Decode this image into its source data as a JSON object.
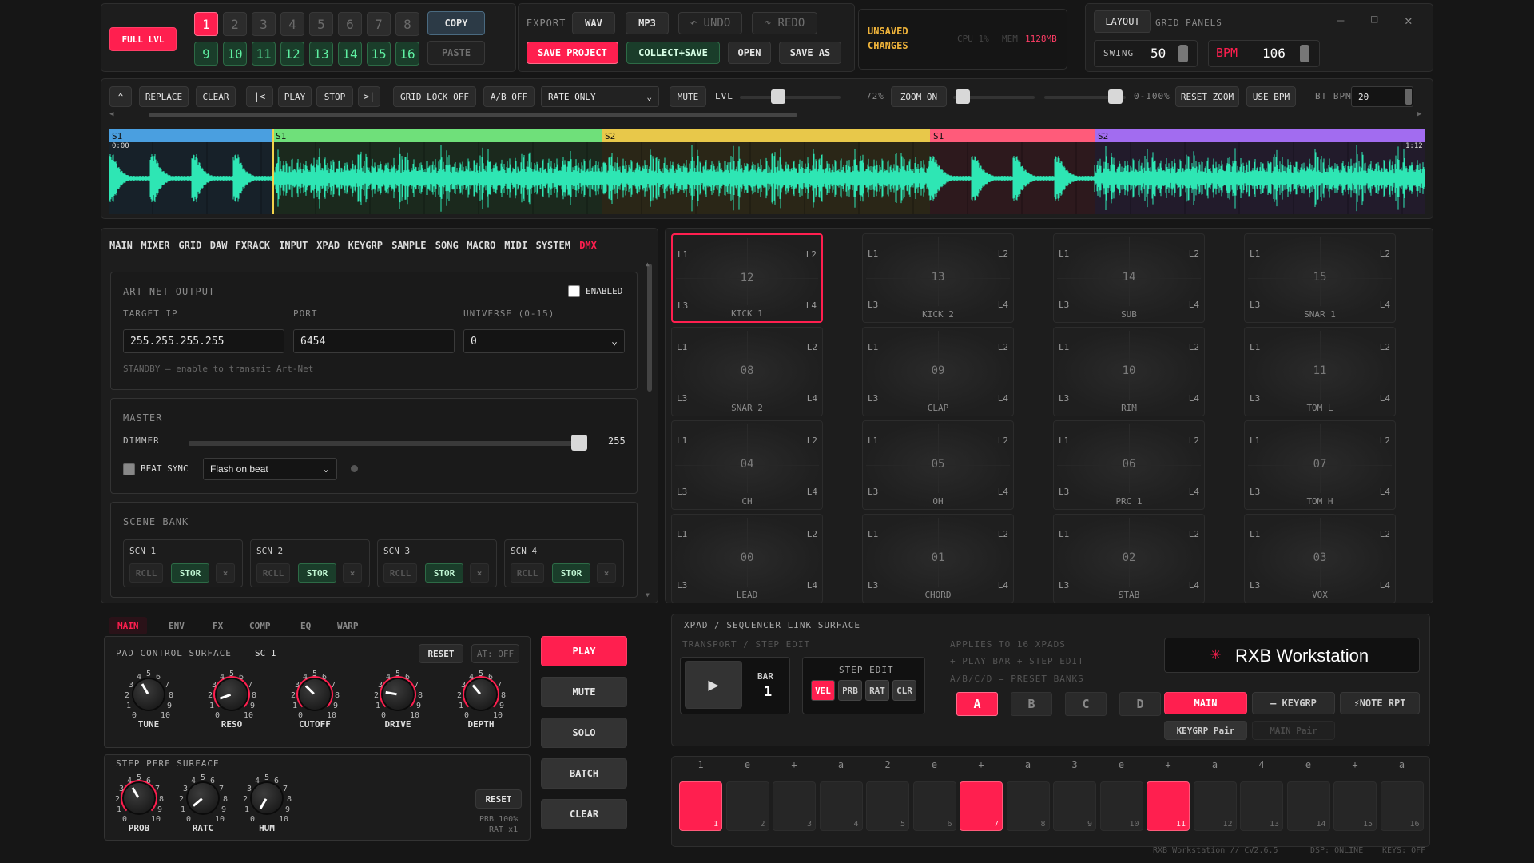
{
  "top": {
    "full_lvl": "FULL LVL",
    "slots": [
      "1",
      "2",
      "3",
      "4",
      "5",
      "6",
      "7",
      "8"
    ],
    "slots2": [
      "9",
      "10",
      "11",
      "12",
      "13",
      "14",
      "15",
      "16"
    ],
    "copy": "COPY",
    "paste": "PASTE",
    "export_label": "EXPORT",
    "wav": "WAV",
    "mp3": "MP3",
    "undo": "↶ UNDO",
    "redo": "↷ REDO",
    "save_project": "SAVE PROJECT",
    "collect_save": "COLLECT+SAVE",
    "open": "OPEN",
    "save_as": "SAVE AS",
    "unsaved": "UNSAVED",
    "changes": "CHANGES",
    "cpu": "CPU 1%",
    "mem_label": "MEM",
    "mem_value": "1128MB",
    "layout": "LAYOUT",
    "grid_panels": "GRID PANELS",
    "swing_label": "SWING",
    "swing_value": "50",
    "bpm_label": "BPM",
    "bpm_value": "106"
  },
  "transport": {
    "replace": "REPLACE",
    "clear": "CLEAR",
    "to_start": "|<",
    "play": "PLAY",
    "stop": "STOP",
    "to_end": ">|",
    "grid_lock": "GRID LOCK OFF",
    "ab": "A/B OFF",
    "rate_only": "RATE ONLY",
    "mute": "MUTE",
    "lvl": "LVL",
    "lvl_value": "72%",
    "zoom_on": "ZOOM ON",
    "range": "0-100%",
    "reset_zoom": "RESET ZOOM",
    "use_bpm": "USE BPM",
    "bt_bpm_label": "BT BPM",
    "bt_bpm_value": "20"
  },
  "waveform": {
    "time_start": "0:00",
    "time_end": "1:12",
    "segments": [
      {
        "label": "S1",
        "color": "#4a9fe0"
      },
      {
        "label": "S1",
        "color": "#6fe07a"
      },
      {
        "label": "S2",
        "color": "#e8c84a"
      },
      {
        "label": "S1",
        "color": "#ff5b7a"
      },
      {
        "label": "S2",
        "color": "#a26cf0"
      }
    ],
    "wave_color": "#2ee6b4"
  },
  "nav": {
    "tabs": [
      "MAIN",
      "MIXER",
      "GRID",
      "DAW",
      "FXRACK",
      "INPUT",
      "XPAD",
      "KEYGRP",
      "SAMPLE",
      "SONG",
      "MACRO",
      "MIDI",
      "SYSTEM",
      "DMX"
    ]
  },
  "artnet": {
    "title": "ART-NET OUTPUT",
    "enabled": "ENABLED",
    "ip_label": "TARGET IP",
    "ip": "255.255.255.255",
    "port_label": "PORT",
    "port": "6454",
    "universe_label": "UNIVERSE (0-15)",
    "universe": "0",
    "status": "STANDBY — enable to transmit Art-Net"
  },
  "master": {
    "title": "MASTER",
    "dimmer_label": "DIMMER",
    "dimmer_value": "255",
    "beat_sync": "BEAT SYNC",
    "flash": "Flash on beat"
  },
  "scenes": {
    "title": "SCENE BANK",
    "items": [
      {
        "name": "SCN 1"
      },
      {
        "name": "SCN 2"
      },
      {
        "name": "SCN 3"
      },
      {
        "name": "SCN 4"
      }
    ],
    "rcll": "RCLL",
    "stor": "STOR",
    "x": "×"
  },
  "pads": [
    {
      "num": "12",
      "name": "KICK 1"
    },
    {
      "num": "13",
      "name": "KICK 2"
    },
    {
      "num": "14",
      "name": "SUB"
    },
    {
      "num": "15",
      "name": "SNAR 1"
    },
    {
      "num": "08",
      "name": "SNAR 2"
    },
    {
      "num": "09",
      "name": "CLAP"
    },
    {
      "num": "10",
      "name": "RIM"
    },
    {
      "num": "11",
      "name": "TOM L"
    },
    {
      "num": "04",
      "name": "CH"
    },
    {
      "num": "05",
      "name": "OH"
    },
    {
      "num": "06",
      "name": "PRC 1"
    },
    {
      "num": "07",
      "name": "TOM H"
    },
    {
      "num": "00",
      "name": "LEAD"
    },
    {
      "num": "01",
      "name": "CHORD"
    },
    {
      "num": "02",
      "name": "STAB"
    },
    {
      "num": "03",
      "name": "VOX"
    }
  ],
  "pad_corners": {
    "l1": "L1",
    "l2": "L2",
    "l3": "L3",
    "l4": "L4"
  },
  "padctl": {
    "tabs": [
      "MAIN",
      "ENV",
      "FX",
      "COMP",
      "EQ",
      "WARP"
    ],
    "title": "PAD CONTROL SURFACE",
    "sc": "SC 1",
    "reset": "RESET",
    "at": "AT: OFF",
    "knobs": [
      {
        "label": "TUNE"
      },
      {
        "label": "RESO"
      },
      {
        "label": "CUTOFF"
      },
      {
        "label": "DRIVE"
      },
      {
        "label": "DEPTH"
      }
    ]
  },
  "steperf": {
    "title": "STEP PERF SURFACE",
    "reset": "RESET",
    "prb": "PRB 100%",
    "rat": "RAT x1",
    "knobs": [
      {
        "label": "PROB"
      },
      {
        "label": "RATC"
      },
      {
        "label": "HUM"
      }
    ]
  },
  "side": {
    "play": "PLAY",
    "mute": "MUTE",
    "solo": "SOLO",
    "batch": "BATCH",
    "clear": "CLEAR"
  },
  "xpad": {
    "title": "XPAD / SEQUENCER LINK SURFACE",
    "sub": "TRANSPORT / STEP EDIT",
    "bar_label": "BAR",
    "bar_value": "1",
    "step_edit": "STEP EDIT",
    "modes": [
      "VEL",
      "PRB",
      "RAT",
      "CLR"
    ],
    "applies": "APPLIES TO 16 XPADS",
    "play_bar": "+ PLAY BAR + STEP EDIT",
    "presets": "A/B/C/D = PRESET BANKS",
    "banks": [
      "A",
      "B",
      "C",
      "D"
    ],
    "brand": "RXB Workstation",
    "main": "MAIN",
    "keygrp": "— KEYGRP",
    "note_rpt": "⚡NOTE RPT",
    "keygrp_pair": "KEYGRP Pair",
    "main_pair": "MAIN Pair"
  },
  "seq": {
    "ticks": [
      "1",
      "e",
      "+",
      "a",
      "2",
      "e",
      "+",
      "a",
      "3",
      "e",
      "+",
      "a",
      "4",
      "e",
      "+",
      "a"
    ],
    "active": [
      1,
      7,
      11
    ]
  },
  "footer": {
    "app": "RXB Workstation // CV2.6.5",
    "dsp": "DSP: ONLINE",
    "keys": "KEYS: OFF"
  },
  "colors": {
    "accent": "#ff1f4f",
    "green": "#2d6b46"
  }
}
